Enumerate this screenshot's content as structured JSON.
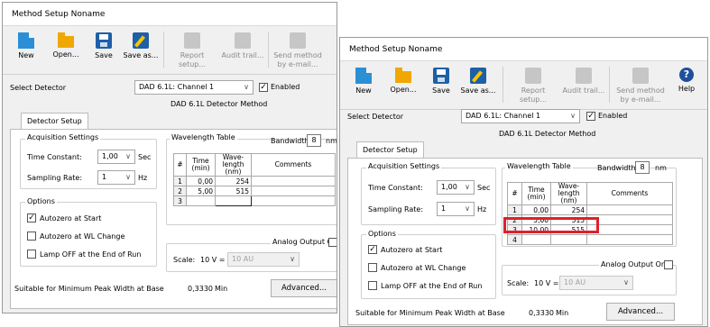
{
  "window_title": "Method Setup Noname",
  "toolbar": {
    "new": "New",
    "open": "Open...",
    "save": "Save",
    "save_as": "Save as...",
    "report_setup": "Report setup...",
    "audit_trail": "Audit trail...",
    "send_method": "Send method by e-mail...",
    "help": "Help"
  },
  "detector": {
    "label": "Select Detector",
    "selected": "DAD 6.1L: Channel 1",
    "enabled_label": "Enabled",
    "enabled": true
  },
  "method_title": "DAD 6.1L Detector Method",
  "tab": "Detector Setup",
  "acquisition": {
    "title": "Acquisition Settings",
    "time_constant_label": "Time Constant:",
    "time_constant_value": "1,00",
    "time_constant_unit": "Sec",
    "sampling_rate_label": "Sampling Rate:",
    "sampling_rate_value": "1",
    "sampling_rate_unit": "Hz"
  },
  "options": {
    "title": "Options",
    "autozero_start": "Autozero at Start",
    "autozero_start_checked": true,
    "autozero_wl": "Autozero at WL Change",
    "autozero_wl_checked": false,
    "lamp_off": "Lamp OFF at the End of Run",
    "lamp_off_checked": false
  },
  "wavelength_table": {
    "title": "Wavelength Table",
    "bandwidth_label": "Bandwidth",
    "bandwidth_value": "8",
    "bandwidth_unit": "nm",
    "col_num": "#",
    "col_time": "Time (min)",
    "col_wave": "Wave- length (nm)",
    "col_comments": "Comments",
    "rows_a": [
      {
        "n": "1",
        "time": "0,00",
        "wave": "254"
      },
      {
        "n": "2",
        "time": "5,00",
        "wave": "515"
      },
      {
        "n": "3",
        "time": "",
        "wave": ""
      }
    ],
    "rows_b": [
      {
        "n": "1",
        "time": "0,00",
        "wave": "254"
      },
      {
        "n": "2",
        "time": "5,00",
        "wave": "515"
      },
      {
        "n": "3",
        "time": "10,00",
        "wave": "515"
      },
      {
        "n": "4",
        "time": "",
        "wave": ""
      }
    ]
  },
  "analog": {
    "label": "Analog Output On",
    "checked": false,
    "scale_label": "Scale:",
    "scale_eq": "10 V =",
    "scale_value": "10 AU"
  },
  "footer": {
    "peak_width_label": "Suitable for Minimum Peak Width at Base",
    "peak_width_value": "0,3330",
    "peak_width_unit": "Min",
    "advanced": "Advanced..."
  }
}
